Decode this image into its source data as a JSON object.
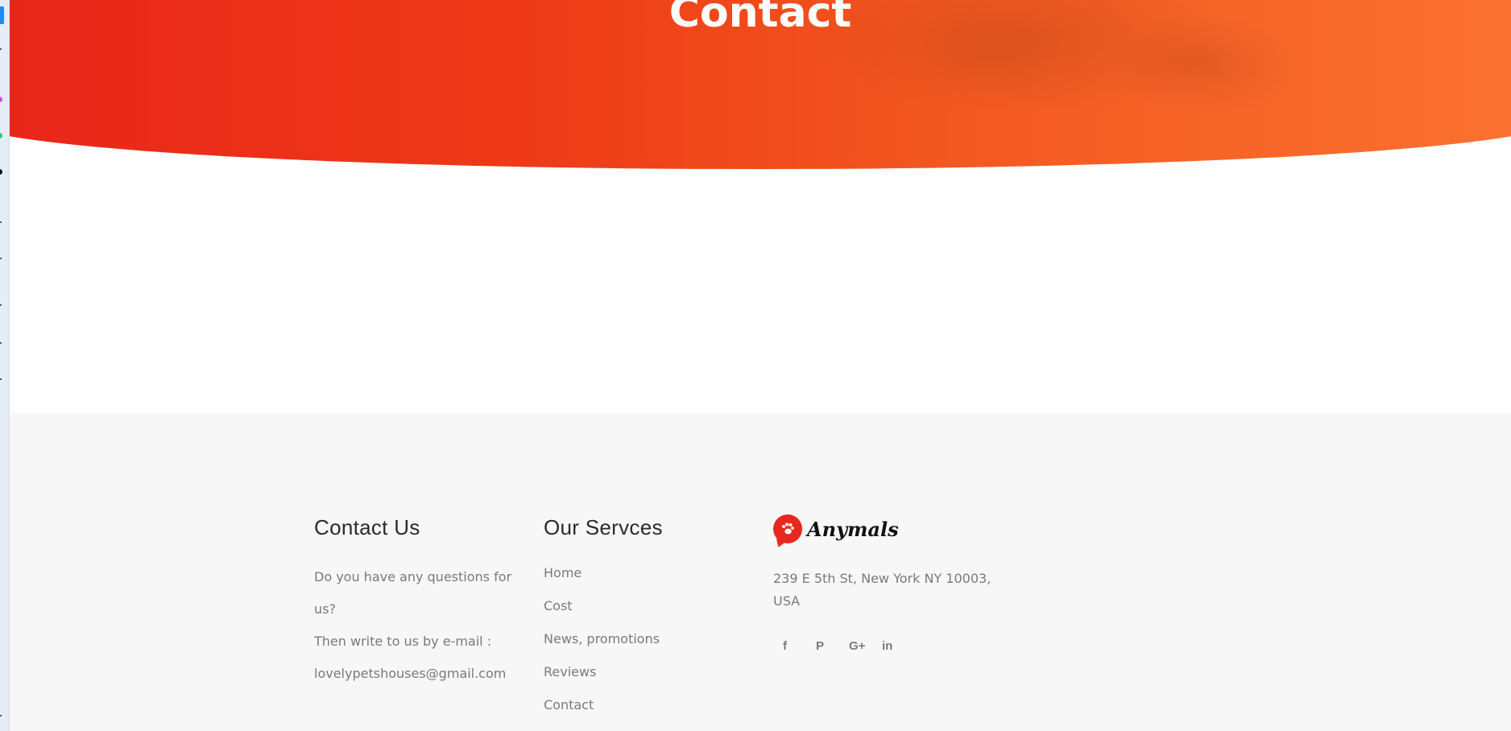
{
  "hero": {
    "title": "Contact"
  },
  "contact_us": {
    "heading": "Contact Us",
    "line1": "Do you have any questions for us?",
    "line2": "Then write to us by e-mail :",
    "email": "lovelypetshouses@gmail.com"
  },
  "services": {
    "heading": "Our Servces",
    "items": [
      {
        "label": "Home"
      },
      {
        "label": "Cost"
      },
      {
        "label": "News, promotions"
      },
      {
        "label": "Reviews"
      },
      {
        "label": "Contact"
      }
    ]
  },
  "brand": {
    "logo_text": "Anymals",
    "address": "239 E 5th St, New York NY 10003, USA",
    "socials": [
      {
        "icon": "facebook-icon",
        "glyph": "f"
      },
      {
        "icon": "pinterest-icon",
        "glyph": "P"
      },
      {
        "icon": "google-plus-icon",
        "glyph": "G+"
      },
      {
        "icon": "linkedin-icon",
        "glyph": "in"
      }
    ]
  },
  "colors": {
    "accent": "#e8281f",
    "hero_start": "#e8241a",
    "hero_end": "#fb7330",
    "footer_bg": "#f7f7f7",
    "text_muted": "#7a7a7a",
    "heading": "#2b2b2b"
  }
}
